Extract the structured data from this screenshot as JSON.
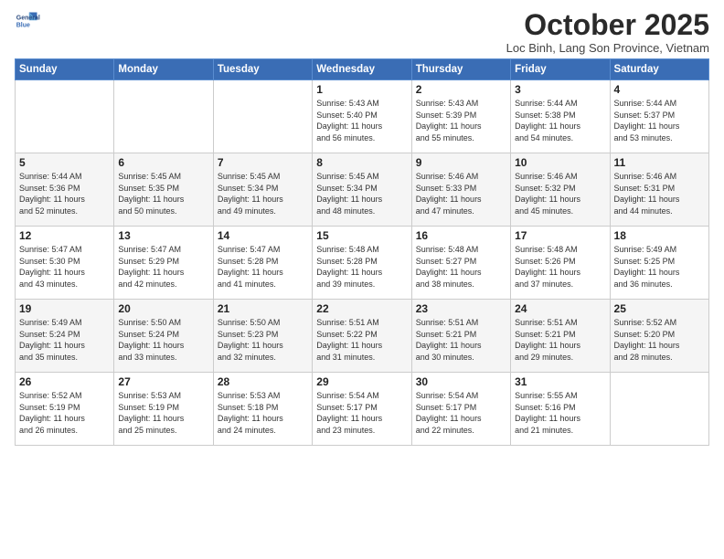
{
  "header": {
    "logo_line1": "General",
    "logo_line2": "Blue",
    "month_title": "October 2025",
    "subtitle": "Loc Binh, Lang Son Province, Vietnam"
  },
  "days_of_week": [
    "Sunday",
    "Monday",
    "Tuesday",
    "Wednesday",
    "Thursday",
    "Friday",
    "Saturday"
  ],
  "weeks": [
    [
      {
        "day": "",
        "info": ""
      },
      {
        "day": "",
        "info": ""
      },
      {
        "day": "",
        "info": ""
      },
      {
        "day": "1",
        "info": "Sunrise: 5:43 AM\nSunset: 5:40 PM\nDaylight: 11 hours\nand 56 minutes."
      },
      {
        "day": "2",
        "info": "Sunrise: 5:43 AM\nSunset: 5:39 PM\nDaylight: 11 hours\nand 55 minutes."
      },
      {
        "day": "3",
        "info": "Sunrise: 5:44 AM\nSunset: 5:38 PM\nDaylight: 11 hours\nand 54 minutes."
      },
      {
        "day": "4",
        "info": "Sunrise: 5:44 AM\nSunset: 5:37 PM\nDaylight: 11 hours\nand 53 minutes."
      }
    ],
    [
      {
        "day": "5",
        "info": "Sunrise: 5:44 AM\nSunset: 5:36 PM\nDaylight: 11 hours\nand 52 minutes."
      },
      {
        "day": "6",
        "info": "Sunrise: 5:45 AM\nSunset: 5:35 PM\nDaylight: 11 hours\nand 50 minutes."
      },
      {
        "day": "7",
        "info": "Sunrise: 5:45 AM\nSunset: 5:34 PM\nDaylight: 11 hours\nand 49 minutes."
      },
      {
        "day": "8",
        "info": "Sunrise: 5:45 AM\nSunset: 5:34 PM\nDaylight: 11 hours\nand 48 minutes."
      },
      {
        "day": "9",
        "info": "Sunrise: 5:46 AM\nSunset: 5:33 PM\nDaylight: 11 hours\nand 47 minutes."
      },
      {
        "day": "10",
        "info": "Sunrise: 5:46 AM\nSunset: 5:32 PM\nDaylight: 11 hours\nand 45 minutes."
      },
      {
        "day": "11",
        "info": "Sunrise: 5:46 AM\nSunset: 5:31 PM\nDaylight: 11 hours\nand 44 minutes."
      }
    ],
    [
      {
        "day": "12",
        "info": "Sunrise: 5:47 AM\nSunset: 5:30 PM\nDaylight: 11 hours\nand 43 minutes."
      },
      {
        "day": "13",
        "info": "Sunrise: 5:47 AM\nSunset: 5:29 PM\nDaylight: 11 hours\nand 42 minutes."
      },
      {
        "day": "14",
        "info": "Sunrise: 5:47 AM\nSunset: 5:28 PM\nDaylight: 11 hours\nand 41 minutes."
      },
      {
        "day": "15",
        "info": "Sunrise: 5:48 AM\nSunset: 5:28 PM\nDaylight: 11 hours\nand 39 minutes."
      },
      {
        "day": "16",
        "info": "Sunrise: 5:48 AM\nSunset: 5:27 PM\nDaylight: 11 hours\nand 38 minutes."
      },
      {
        "day": "17",
        "info": "Sunrise: 5:48 AM\nSunset: 5:26 PM\nDaylight: 11 hours\nand 37 minutes."
      },
      {
        "day": "18",
        "info": "Sunrise: 5:49 AM\nSunset: 5:25 PM\nDaylight: 11 hours\nand 36 minutes."
      }
    ],
    [
      {
        "day": "19",
        "info": "Sunrise: 5:49 AM\nSunset: 5:24 PM\nDaylight: 11 hours\nand 35 minutes."
      },
      {
        "day": "20",
        "info": "Sunrise: 5:50 AM\nSunset: 5:24 PM\nDaylight: 11 hours\nand 33 minutes."
      },
      {
        "day": "21",
        "info": "Sunrise: 5:50 AM\nSunset: 5:23 PM\nDaylight: 11 hours\nand 32 minutes."
      },
      {
        "day": "22",
        "info": "Sunrise: 5:51 AM\nSunset: 5:22 PM\nDaylight: 11 hours\nand 31 minutes."
      },
      {
        "day": "23",
        "info": "Sunrise: 5:51 AM\nSunset: 5:21 PM\nDaylight: 11 hours\nand 30 minutes."
      },
      {
        "day": "24",
        "info": "Sunrise: 5:51 AM\nSunset: 5:21 PM\nDaylight: 11 hours\nand 29 minutes."
      },
      {
        "day": "25",
        "info": "Sunrise: 5:52 AM\nSunset: 5:20 PM\nDaylight: 11 hours\nand 28 minutes."
      }
    ],
    [
      {
        "day": "26",
        "info": "Sunrise: 5:52 AM\nSunset: 5:19 PM\nDaylight: 11 hours\nand 26 minutes."
      },
      {
        "day": "27",
        "info": "Sunrise: 5:53 AM\nSunset: 5:19 PM\nDaylight: 11 hours\nand 25 minutes."
      },
      {
        "day": "28",
        "info": "Sunrise: 5:53 AM\nSunset: 5:18 PM\nDaylight: 11 hours\nand 24 minutes."
      },
      {
        "day": "29",
        "info": "Sunrise: 5:54 AM\nSunset: 5:17 PM\nDaylight: 11 hours\nand 23 minutes."
      },
      {
        "day": "30",
        "info": "Sunrise: 5:54 AM\nSunset: 5:17 PM\nDaylight: 11 hours\nand 22 minutes."
      },
      {
        "day": "31",
        "info": "Sunrise: 5:55 AM\nSunset: 5:16 PM\nDaylight: 11 hours\nand 21 minutes."
      },
      {
        "day": "",
        "info": ""
      }
    ]
  ]
}
